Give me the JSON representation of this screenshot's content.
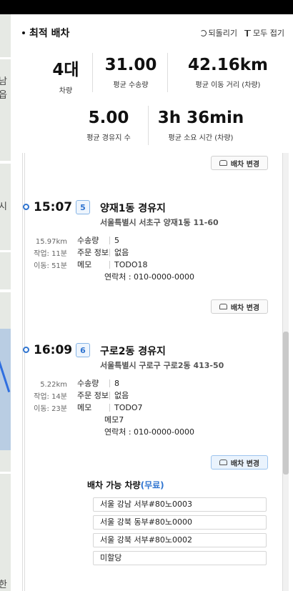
{
  "map": {
    "labels": [
      "남읍",
      "시",
      "한"
    ]
  },
  "header": {
    "title": "최적 배차",
    "undo_label": "되돌리기",
    "collapse_label": "모두 접기"
  },
  "stats": {
    "vehicles": {
      "value": "4대",
      "label": "차량"
    },
    "avg_qty": {
      "value": "31.00",
      "label": "평균 수송량"
    },
    "avg_dist": {
      "value": "42.16km",
      "label": "평균 이동 거리 (차량)"
    },
    "avg_stops": {
      "value": "5.00",
      "label": "평균 경유지 수"
    },
    "avg_time": {
      "value": "3h 36min",
      "label": "평균 소요 시간 (차량)"
    }
  },
  "change_label": "배차 변경",
  "stops": [
    {
      "time": "15:07",
      "index": "5",
      "name": "양재1동 경유지",
      "address": "서울특별시 서초구 양재1동 11-60",
      "distance": "15.97km",
      "work": "작업: 11분",
      "move": "이동: 51분",
      "qty_label": "수송량",
      "qty": "5",
      "order_label": "주문 정보",
      "order": "없음",
      "memo_label": "메모",
      "memo_lines": [
        "TODO18"
      ],
      "contact": "연락처 : 010-0000-0000"
    },
    {
      "time": "16:09",
      "index": "6",
      "name": "구로2동 경유지",
      "address": "서울특별시 구로구 구로2동 413-50",
      "distance": "5.22km",
      "work": "작업: 14분",
      "move": "이동: 23분",
      "qty_label": "수송량",
      "qty": "8",
      "order_label": "주문 정보",
      "order": "없음",
      "memo_label": "메모",
      "memo_lines": [
        "TODO7",
        "메모7"
      ],
      "contact": "연락처 : 010-0000-0000"
    }
  ],
  "available": {
    "title": "배차 가능 차량",
    "free": "(무료)",
    "vehicles": [
      "서울 강남 서부#80노0003",
      "서울 강북 동부#80노0000",
      "서울 강북 서부#80노0002",
      "미할당"
    ]
  }
}
